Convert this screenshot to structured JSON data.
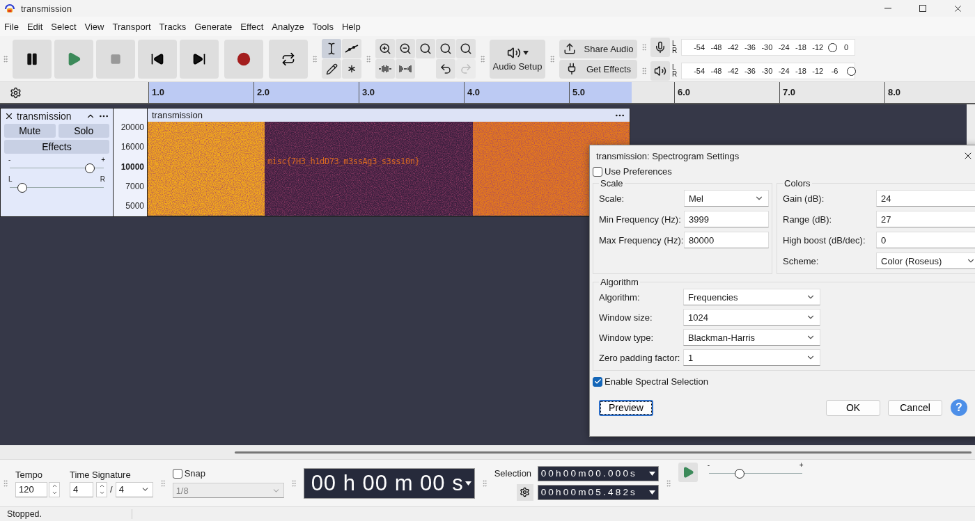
{
  "window": {
    "title": "transmission"
  },
  "menu": [
    "File",
    "Edit",
    "Select",
    "View",
    "Transport",
    "Tracks",
    "Generate",
    "Effect",
    "Analyze",
    "Tools",
    "Help"
  ],
  "transport": [
    {
      "kind": "pause"
    },
    {
      "kind": "play"
    },
    {
      "kind": "stop"
    },
    {
      "kind": "skip_start"
    },
    {
      "kind": "skip_end"
    },
    {
      "kind": "record"
    },
    {
      "kind": "loop"
    }
  ],
  "tools": [
    {
      "kind": "select",
      "selected": true
    },
    {
      "kind": "envelope",
      "selected": false
    },
    {
      "kind": "draw",
      "selected": false
    },
    {
      "kind": "multi",
      "selected": false
    }
  ],
  "edit_tools": [
    {
      "kind": "zoom_in",
      "disabled": false
    },
    {
      "kind": "zoom_out",
      "disabled": false
    },
    {
      "kind": "fit_selection",
      "disabled": false
    },
    {
      "kind": "fit_project",
      "disabled": false
    },
    {
      "kind": "zoom_toggle",
      "disabled": false
    },
    {
      "kind": "trim",
      "disabled": false
    },
    {
      "kind": "silence",
      "disabled": false
    },
    {
      "kind": "undo",
      "disabled": false
    },
    {
      "kind": "redo",
      "disabled": true
    }
  ],
  "audio_setup": "Audio Setup",
  "share_audio": "Share Audio",
  "get_effects": "Get Effects",
  "meters": [
    {
      "kind": "record",
      "channels": [
        "L",
        "R"
      ],
      "ticks": [
        "-54",
        "-48",
        "-42",
        "-36",
        "-30",
        "-24",
        "-18",
        "-12"
      ],
      "end_label": "0",
      "level": 0.87
    },
    {
      "kind": "playback",
      "channels": [
        "L",
        "R"
      ],
      "ticks": [
        "-54",
        "-48",
        "-42",
        "-36",
        "-30",
        "-24",
        "-18",
        "-12",
        "-6"
      ],
      "level": 0.98
    }
  ],
  "ruler": {
    "labels": [
      "1.0",
      "2.0",
      "3.0",
      "4.0",
      "5.0",
      "6.0",
      "7.0",
      "8.0"
    ]
  },
  "track": {
    "name": "transmission",
    "mute": "Mute",
    "solo": "Solo",
    "effects": "Effects",
    "gain": {
      "marks": [
        "-",
        "+"
      ],
      "level": 0.85
    },
    "pan": {
      "marks": [
        "L",
        "R"
      ],
      "level": 0.13
    },
    "axis": [
      {
        "label": "20000",
        "major": false
      },
      {
        "label": "16000",
        "major": false
      },
      {
        "label": "10000",
        "major": true
      },
      {
        "label": "7000",
        "major": false
      },
      {
        "label": "5000",
        "major": false
      }
    ],
    "clip_title": "transmission",
    "hidden_text": "misc{7H3_h1dD73_m3ssAg3_s3ss10n}"
  },
  "dialog": {
    "title": "transmission: Spectrogram Settings",
    "use_preferences": {
      "label": "Use Preferences",
      "checked": false
    },
    "scale": {
      "title": "Scale",
      "rows": [
        {
          "label": "Scale:",
          "value": "Mel",
          "kind": "select"
        },
        {
          "label": "Min Frequency (Hz):",
          "value": "3999",
          "kind": "text"
        },
        {
          "label": "Max Frequency (Hz):",
          "value": "80000",
          "kind": "text"
        }
      ]
    },
    "colors": {
      "title": "Colors",
      "rows": [
        {
          "label": "Gain (dB):",
          "value": "24",
          "kind": "text"
        },
        {
          "label": "Range (dB):",
          "value": "27",
          "kind": "text"
        },
        {
          "label": "High boost (dB/dec):",
          "value": "0",
          "kind": "text"
        },
        {
          "label": "Scheme:",
          "value": "Color (Roseus)",
          "kind": "select"
        }
      ]
    },
    "algorithm": {
      "title": "Algorithm",
      "rows": [
        {
          "label": "Algorithm:",
          "value": "Frequencies",
          "kind": "select"
        },
        {
          "label": "Window size:",
          "value": "1024",
          "kind": "select"
        },
        {
          "label": "Window type:",
          "value": "Blackman-Harris",
          "kind": "select"
        },
        {
          "label": "Zero padding factor:",
          "value": "1",
          "kind": "select"
        }
      ]
    },
    "spectral_selection": {
      "label": "Enable Spectral Selection",
      "checked": true
    },
    "preview": "Preview",
    "ok": "OK",
    "cancel": "Cancel",
    "help": "?"
  },
  "bottom": {
    "tempo": {
      "label": "Tempo",
      "value": "120"
    },
    "time_signature": {
      "label": "Time Signature",
      "upper": "4",
      "separator": "/",
      "lower": "4"
    },
    "snap": {
      "label": "Snap",
      "checked": false,
      "value": "1/8"
    },
    "time": "00 h 00 m 00 s",
    "selection": {
      "label": "Selection",
      "start": "00h00m00.000s",
      "end": "00h00m05.482s"
    },
    "speed": {
      "marks": [
        "-",
        "+"
      ],
      "level": 0.33
    }
  },
  "status": "Stopped."
}
